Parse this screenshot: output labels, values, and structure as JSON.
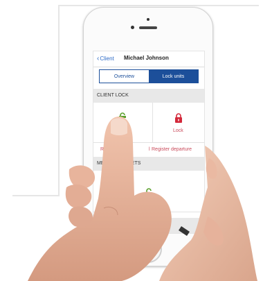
{
  "nav": {
    "back_label": "Client",
    "title": "Michael Johnson"
  },
  "tabs": [
    {
      "label": "Overview",
      "selected": false
    },
    {
      "label": "Lock units",
      "selected": true
    }
  ],
  "client_lock": {
    "header": "CLIENT LOCK",
    "lock_label": "Lock",
    "register_arrival_visible": "Re",
    "register_arrival_tail": "l",
    "register_departure": "Register departure"
  },
  "medicine_cabinets": {
    "header_start": "MEDI",
    "header_end": "ABINETS",
    "unlock_label": "Unlock"
  },
  "colors": {
    "accent_blue": "#1c4f9a",
    "lock_red": "#d3283a",
    "unlock_green": "#5aa02c",
    "link_red": "#c94a5a",
    "section_grey": "#e8e8e8"
  },
  "icons": [
    "chevron-left-icon",
    "lock-red-icon",
    "lock-green-icon"
  ]
}
